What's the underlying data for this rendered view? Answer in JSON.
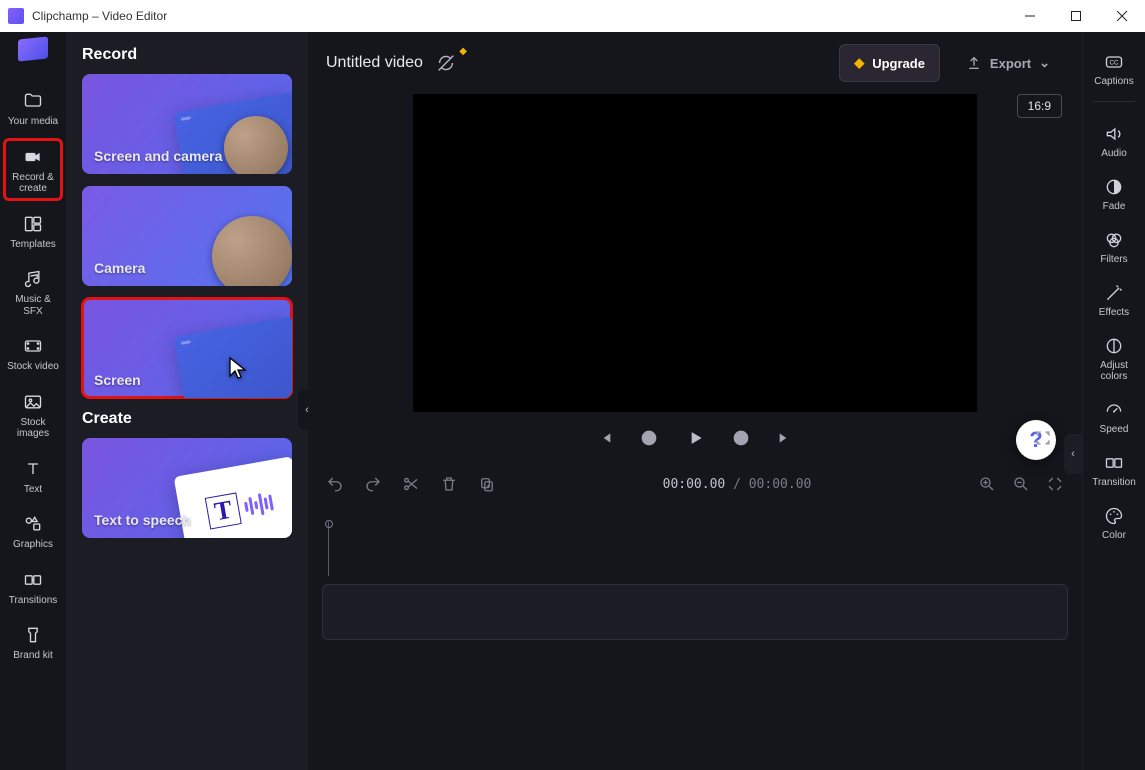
{
  "window": {
    "title": "Clipchamp – Video Editor"
  },
  "left_nav": {
    "items": [
      {
        "label": "Your media",
        "icon": "folder-icon"
      },
      {
        "label": "Record & create",
        "icon": "video-icon",
        "active": true
      },
      {
        "label": "Templates",
        "icon": "templates-icon"
      },
      {
        "label": "Music & SFX",
        "icon": "music-icon"
      },
      {
        "label": "Stock video",
        "icon": "stockvideo-icon"
      },
      {
        "label": "Stock images",
        "icon": "stockimage-icon"
      },
      {
        "label": "Text",
        "icon": "text-icon"
      },
      {
        "label": "Graphics",
        "icon": "graphics-icon"
      },
      {
        "label": "Transitions",
        "icon": "transitions-icon"
      },
      {
        "label": "Brand kit",
        "icon": "brandkit-icon"
      }
    ]
  },
  "record_panel": {
    "section_record": "Record",
    "section_create": "Create",
    "cards": {
      "screen_and_camera": "Screen and camera",
      "camera": "Camera",
      "screen": "Screen",
      "tts": "Text to speech"
    }
  },
  "editor": {
    "title": "Untitled video",
    "upgrade_label": "Upgrade",
    "export_label": "Export",
    "aspect": "16:9",
    "timecode_current": "00:00.00",
    "timecode_total": "00:00.00"
  },
  "right_nav": {
    "items": [
      {
        "label": "Captions",
        "icon": "cc-icon"
      },
      {
        "label": "Audio",
        "icon": "speaker-icon"
      },
      {
        "label": "Fade",
        "icon": "fade-icon"
      },
      {
        "label": "Filters",
        "icon": "filters-icon"
      },
      {
        "label": "Effects",
        "icon": "effects-icon"
      },
      {
        "label": "Adjust colors",
        "icon": "adjust-icon"
      },
      {
        "label": "Speed",
        "icon": "speed-icon"
      },
      {
        "label": "Transition",
        "icon": "transition-icon"
      },
      {
        "label": "Color",
        "icon": "color-icon"
      }
    ]
  }
}
